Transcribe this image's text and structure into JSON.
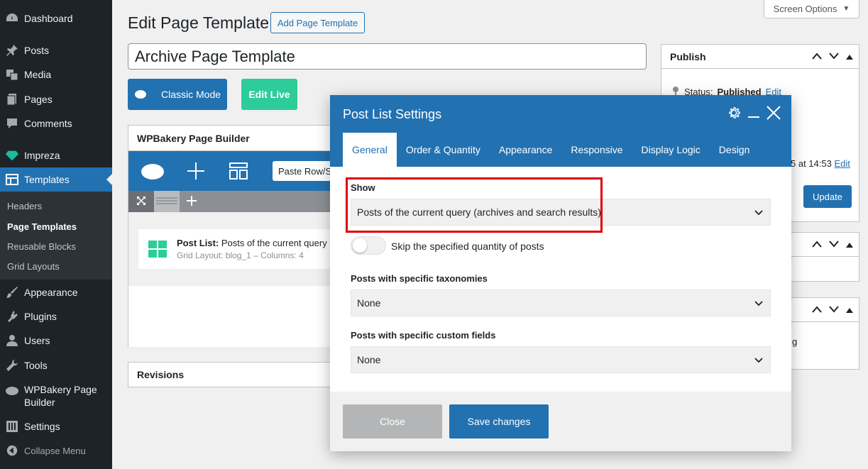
{
  "sidebar": {
    "items": [
      {
        "label": "Dashboard",
        "icon": "dashboard-icon"
      },
      {
        "label": "Posts",
        "icon": "pin-icon"
      },
      {
        "label": "Media",
        "icon": "media-icon"
      },
      {
        "label": "Pages",
        "icon": "pages-icon"
      },
      {
        "label": "Comments",
        "icon": "comment-icon"
      },
      {
        "label": "Impreza",
        "icon": "diamond-icon"
      },
      {
        "label": "Templates",
        "icon": "templates-icon"
      },
      {
        "label": "Appearance",
        "icon": "brush-icon"
      },
      {
        "label": "Plugins",
        "icon": "plugin-icon"
      },
      {
        "label": "Users",
        "icon": "users-icon"
      },
      {
        "label": "Tools",
        "icon": "wrench-icon"
      },
      {
        "label": "WPBakery Page Builder",
        "icon": "cloud-icon"
      },
      {
        "label": "Settings",
        "icon": "settings-icon"
      }
    ],
    "submenu": [
      "Headers",
      "Page Templates",
      "Reusable Blocks",
      "Grid Layouts"
    ],
    "collapse": "Collapse Menu"
  },
  "header": {
    "title": "Edit Page Template",
    "add_button": "Add Page Template",
    "screen_options": "Screen Options"
  },
  "post_title": "Archive Page Template",
  "builder": {
    "classic_mode": "Classic Mode",
    "edit_live": "Edit Live",
    "box_title": "WPBakery Page Builder",
    "paste_placeholder": "Paste Row/Section",
    "element_name": "Post List:",
    "element_desc": " Posts of the current query (a",
    "element_sub": "Grid Layout: blog_1 – Columns: 4"
  },
  "revisions": "Revisions",
  "publish": {
    "title": "Publish",
    "status_label": "Status:",
    "status_value": "Published",
    "edit": "Edit",
    "date_fragment": "5 at 14:53",
    "date_edit": "Edit",
    "update": "Update",
    "other_fragment": "g"
  },
  "modal": {
    "title": "Post List Settings",
    "tabs": [
      "General",
      "Order & Quantity",
      "Appearance",
      "Responsive",
      "Display Logic",
      "Design"
    ],
    "show_label": "Show",
    "show_value": "Posts of the current query (archives and search results)",
    "skip_label": "Skip the specified quantity of posts",
    "taxonomies_label": "Posts with specific taxonomies",
    "taxonomies_value": "None",
    "custom_fields_label": "Posts with specific custom fields",
    "custom_fields_value": "None",
    "close": "Close",
    "save": "Save changes"
  },
  "colors": {
    "accent": "#2271b1",
    "edit_live": "#2ecc99",
    "highlight": "#e00000",
    "sidebar": "#1d2327"
  }
}
